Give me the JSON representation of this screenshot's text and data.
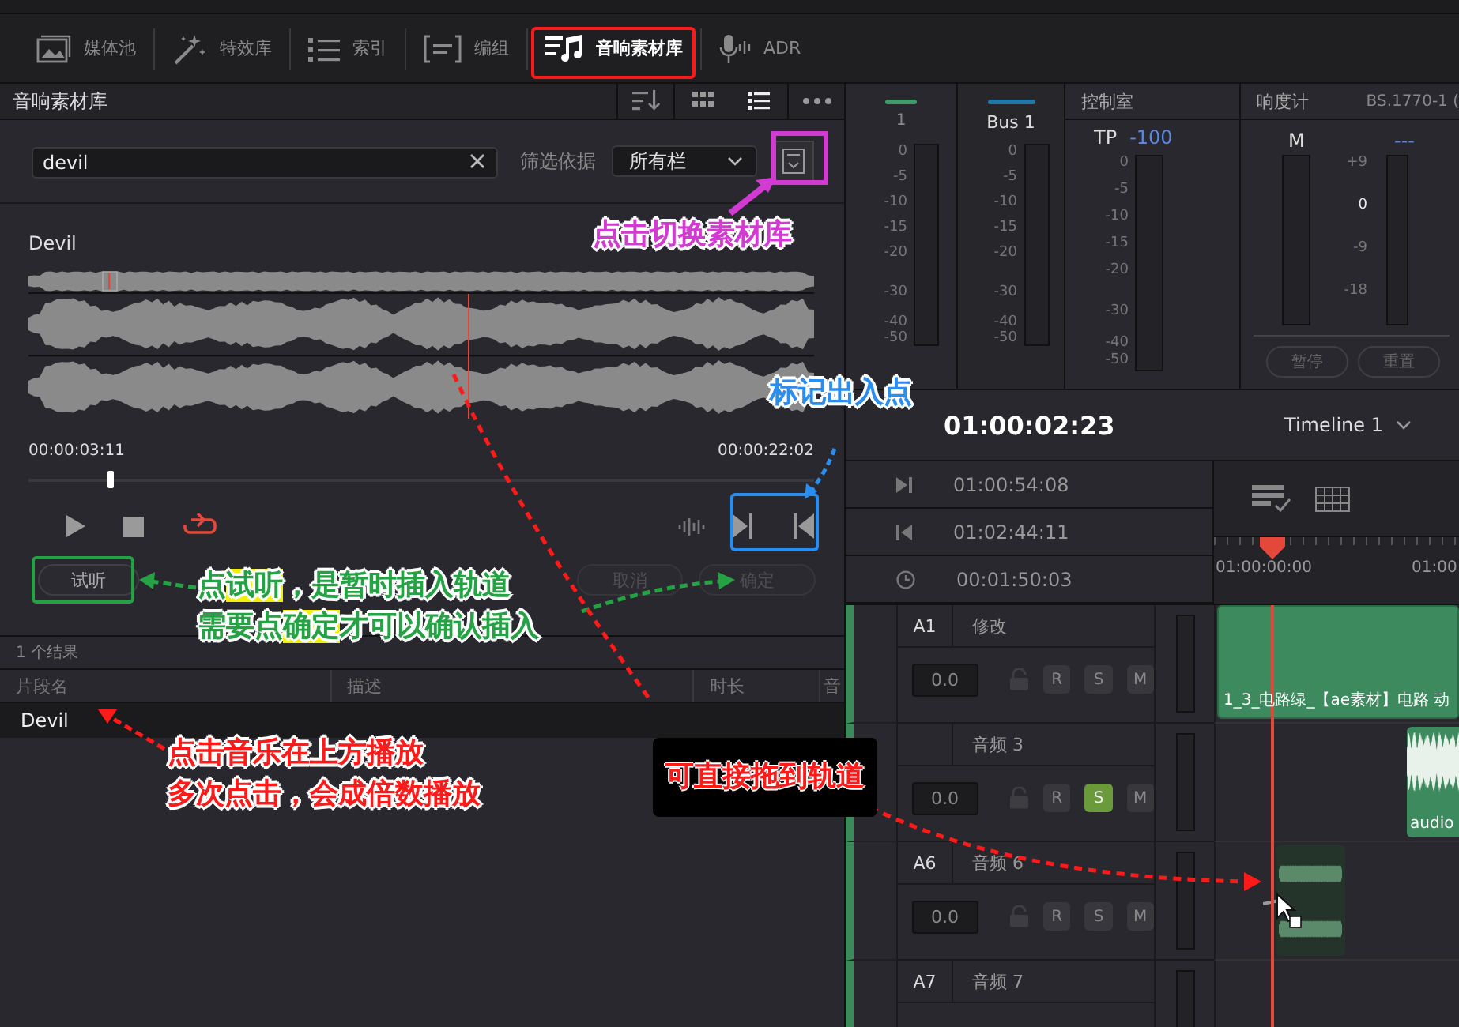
{
  "toolbar": {
    "tabs": [
      {
        "label": "媒体池",
        "selected": false
      },
      {
        "label": "特效库",
        "selected": false
      },
      {
        "label": "索引",
        "selected": false
      },
      {
        "label": "编组",
        "selected": false
      },
      {
        "label": "音响素材库",
        "selected": true
      },
      {
        "label": "ADR",
        "selected": false
      }
    ]
  },
  "library": {
    "title": "音响素材库",
    "search": {
      "value": "devil"
    },
    "filter_label": "筛选依据",
    "filter_select": "所有栏",
    "preview": {
      "title": "Devil",
      "playhead": {
        "level": 0.56
      },
      "start_time": "00:00:03:11",
      "end_time": "00:00:22:02",
      "scrubber": {
        "level": 0.1
      }
    },
    "buttons": [
      {
        "label": "试听",
        "disabled": false
      },
      {
        "label": "取消",
        "disabled": true
      },
      {
        "label": "确定",
        "disabled": true
      }
    ],
    "result_count": "1 个结果",
    "columns": [
      "片段名",
      "描述",
      "时长",
      "音"
    ],
    "rows": [
      {
        "name": "Devil"
      }
    ]
  },
  "mixer": {
    "strips": [
      {
        "label": "1",
        "color": "#3f9a6c",
        "scale": [
          "0",
          "-5",
          "-10",
          "-15",
          "-20",
          "-30",
          "-40",
          "-50"
        ]
      },
      {
        "label": "Bus 1",
        "color": "#1f78a6",
        "scale": [
          "0",
          "-5",
          "-10",
          "-15",
          "-20",
          "-30",
          "-40",
          "-50"
        ]
      }
    ]
  },
  "control_room": {
    "title": "控制室",
    "tp_label": "TP",
    "tp_value": "-100",
    "scale": [
      "0",
      "-5",
      "-10",
      "-15",
      "-20",
      "-30",
      "-40",
      "-50"
    ]
  },
  "loudness": {
    "title": "响度计",
    "standard": "BS.1770-1 (",
    "m_label": "M",
    "m_value": "---",
    "scale": [
      "+9",
      "0",
      "-9",
      "-18"
    ],
    "buttons": [
      "暂停",
      "重置"
    ]
  },
  "timeline": {
    "timecode": "01:00:02:23",
    "name": "Timeline 1",
    "info": [
      {
        "kind": "out",
        "value": "01:00:54:08"
      },
      {
        "kind": "in",
        "value": "01:02:44:11"
      },
      {
        "kind": "duration",
        "value": "00:01:50:03"
      }
    ],
    "ruler": [
      "01:00:00:00",
      "01:00"
    ],
    "tracks": [
      {
        "id": "A1",
        "name": "修改",
        "volume": "0.0",
        "controls": [
          {
            "label": "R",
            "on": false
          },
          {
            "label": "S",
            "on": false
          },
          {
            "label": "M",
            "on": false
          }
        ],
        "clip": {
          "kind": "wide",
          "label": "1_3_电路绿_【ae素材】电路 动"
        }
      },
      {
        "name": "音频 3",
        "volume": "0.0",
        "controls": [
          {
            "label": "R",
            "on": false
          },
          {
            "label": "S",
            "on": true
          },
          {
            "label": "M",
            "on": false
          }
        ],
        "clip": {
          "kind": "waveform",
          "label": "audio"
        }
      },
      {
        "id": "A6",
        "name": "音频 6",
        "volume": "0.0",
        "controls": [
          {
            "label": "R",
            "on": false
          },
          {
            "label": "S",
            "on": false
          },
          {
            "label": "M",
            "on": false
          }
        ],
        "clip": {
          "kind": "dragging"
        }
      },
      {
        "id": "A7",
        "name": "音频 7"
      }
    ]
  },
  "annotations": [
    {
      "kind": "plain",
      "text": "点击切换素材库",
      "color": "#d23ad2"
    },
    {
      "kind": "plain",
      "text": "标记出入点",
      "color": "#2a8ef0"
    },
    {
      "kind": "plain",
      "text": "点**试听**，是暂时插入轨道",
      "color": "#25a244"
    },
    {
      "kind": "plain",
      "text": "需要点**确定**才可以确认插入",
      "color": "#25a244"
    },
    {
      "kind": "plain",
      "text": "点击音乐在上方播放",
      "color": "#ff1a1a"
    },
    {
      "kind": "boxed",
      "text": "可直接拖到轨道",
      "color": "#ff1a1a"
    },
    {
      "kind": "plain",
      "text": "多次点击，会成倍数播放",
      "color": "#ff1a1a"
    }
  ]
}
